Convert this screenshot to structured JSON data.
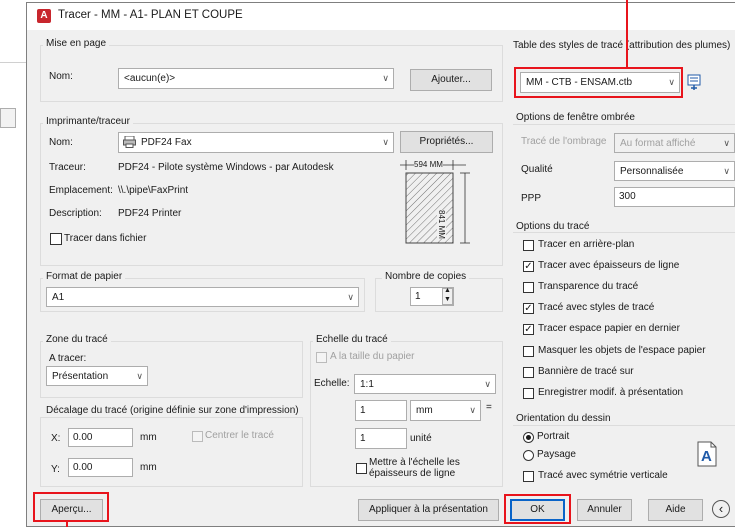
{
  "dialog": {
    "title": "Tracer - MM - A1- PLAN ET COUPE",
    "app_icon": "A",
    "accent_color": "#0a64c8",
    "highlight_color": "#e8141c"
  },
  "mise_en_page": {
    "label": "Mise en page",
    "name_label": "Nom:",
    "name_value": "<aucun(e)>",
    "add_button": "Ajouter..."
  },
  "imprimante": {
    "label": "Imprimante/traceur",
    "name_label": "Nom:",
    "printer_value": "PDF24 Fax",
    "properties_button": "Propriétés...",
    "traceur_label": "Traceur:",
    "traceur_value": "PDF24 - Pilote système Windows - par Autodesk",
    "emplacement_label": "Emplacement:",
    "emplacement_value": "\\\\.\\pipe\\FaxPrint",
    "description_label": "Description:",
    "description_value": "PDF24 Printer",
    "tracer_fichier": "Tracer dans fichier",
    "preview_width": "594 MM",
    "preview_height": "841 MM"
  },
  "format_papier": {
    "label": "Format de papier",
    "value": "A1"
  },
  "copies": {
    "label": "Nombre de copies",
    "value": "1"
  },
  "zone": {
    "label": "Zone du tracé",
    "a_tracer_label": "A tracer:",
    "a_tracer_value": "Présentation"
  },
  "echelle": {
    "label": "Echelle du tracé",
    "fit_paper": "A la taille du papier",
    "scale_label": "Echelle:",
    "scale_value": "1:1",
    "value1": "1",
    "unit_value": "mm",
    "equals": "=",
    "value2": "1",
    "unit2_label": "unité",
    "scale_lineweights": "Mettre à l'échelle les épaisseurs de ligne"
  },
  "decalage": {
    "label": "Décalage du tracé (origine définie sur zone d'impression)",
    "x_label": "X:",
    "x_value": "0.00",
    "x_unit": "mm",
    "center_label": "Centrer le tracé",
    "y_label": "Y:",
    "y_value": "0.00",
    "y_unit": "mm"
  },
  "table_styles": {
    "label": "Table des styles de tracé (attribution des plumes)",
    "value": "MM - CTB - ENSAM.ctb"
  },
  "ombree": {
    "label": "Options de fenêtre ombrée",
    "trace_label": "Tracé de l'ombrage",
    "trace_value": "Au format affiché",
    "qualite_label": "Qualité",
    "qualite_value": "Personnalisée",
    "ppp_label": "PPP",
    "ppp_value": "300"
  },
  "options": {
    "label": "Options du tracé",
    "items": [
      {
        "label": "Tracer en arrière-plan",
        "checked": "",
        "state": "unchecked"
      },
      {
        "label": "Tracer avec épaisseurs de ligne",
        "checked": "✓",
        "state": "checked"
      },
      {
        "label": "Transparence du tracé",
        "checked": "",
        "state": "unchecked"
      },
      {
        "label": "Tracé avec styles de tracé",
        "checked": "✓",
        "state": "checked"
      },
      {
        "label": "Tracer espace papier en dernier",
        "checked": "✓",
        "state": "checked"
      },
      {
        "label": "Masquer les objets de l'espace papier",
        "checked": "",
        "state": "unchecked"
      },
      {
        "label": "Bannière de tracé sur",
        "checked": "",
        "state": "unchecked"
      },
      {
        "label": "Enregistrer modif. à présentation",
        "checked": "",
        "state": "unchecked"
      }
    ]
  },
  "orientation": {
    "label": "Orientation du dessin",
    "portrait": "Portrait",
    "paysage": "Paysage",
    "symetrie": "Tracé avec symétrie verticale",
    "orient_icon": "A"
  },
  "footer": {
    "apercu": "Aperçu...",
    "appliquer": "Appliquer à la présentation",
    "ok": "OK",
    "annuler": "Annuler",
    "aide": "Aide",
    "collapse_icon": "‹"
  },
  "icons": {
    "printer": "printer-icon",
    "edit_styles": "edit-plot-style-icon",
    "chevron": "chevron-down-icon"
  }
}
